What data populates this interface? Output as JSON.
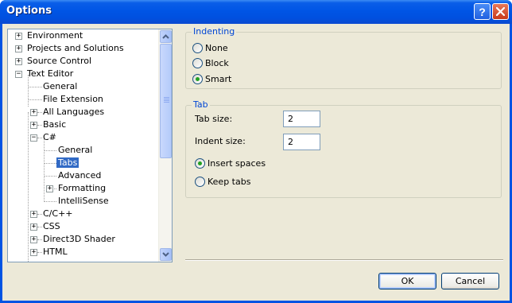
{
  "window": {
    "title": "Options",
    "help_glyph": "?",
    "close_icon": "close-icon"
  },
  "tree": {
    "items": [
      {
        "label": "Environment",
        "expander": "+"
      },
      {
        "label": "Projects and Solutions",
        "expander": "+"
      },
      {
        "label": "Source Control",
        "expander": "+"
      },
      {
        "label": "Text Editor",
        "expander": "−"
      },
      {
        "label": "General"
      },
      {
        "label": "File Extension"
      },
      {
        "label": "All Languages",
        "expander": "+"
      },
      {
        "label": "Basic",
        "expander": "+"
      },
      {
        "label": "C#",
        "expander": "−"
      },
      {
        "label": "General"
      },
      {
        "label": "Tabs",
        "selected": true
      },
      {
        "label": "Advanced"
      },
      {
        "label": "Formatting",
        "expander": "+"
      },
      {
        "label": "IntelliSense"
      },
      {
        "label": "C/C++",
        "expander": "+"
      },
      {
        "label": "CSS",
        "expander": "+"
      },
      {
        "label": "Direct3D Shader",
        "expander": "+"
      },
      {
        "label": "HTML",
        "expander": "+"
      }
    ]
  },
  "indenting": {
    "title": "Indenting",
    "options": [
      {
        "label": "None",
        "checked": false
      },
      {
        "label": "Block",
        "checked": false
      },
      {
        "label": "Smart",
        "checked": true
      }
    ]
  },
  "tab": {
    "title": "Tab",
    "tab_size_label": "Tab size:",
    "tab_size_value": "2",
    "indent_size_label": "Indent size:",
    "indent_size_value": "2",
    "options": [
      {
        "label": "Insert spaces",
        "checked": true
      },
      {
        "label": "Keep tabs",
        "checked": false
      }
    ]
  },
  "buttons": {
    "ok": "OK",
    "cancel": "Cancel"
  },
  "colors": {
    "title_bar": "#0055e5",
    "selection": "#316ac5",
    "group_title": "#0046d5",
    "radio_dot": "#21a121"
  }
}
